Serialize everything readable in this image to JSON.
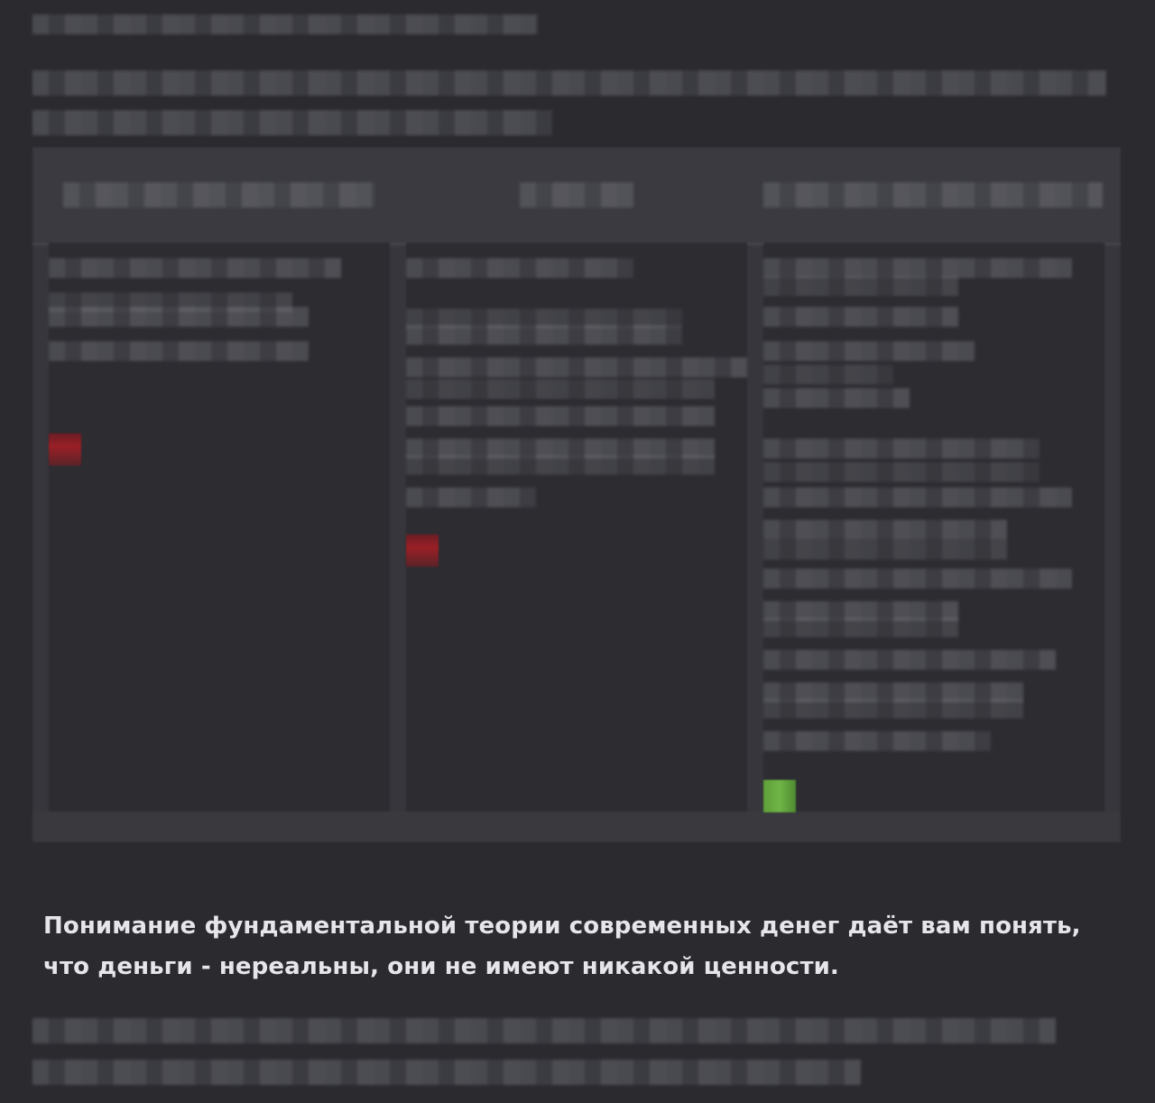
{
  "message": {
    "visible_text": "Понимание фундаментальной теории современных денег даёт вам понять, что деньги - нереальны, они не имеют никакой ценности."
  },
  "colors": {
    "background": "#2a2a2f",
    "text": "#e6e6ea",
    "red_marker": "#9a1f26",
    "green_marker": "#6fb545"
  }
}
